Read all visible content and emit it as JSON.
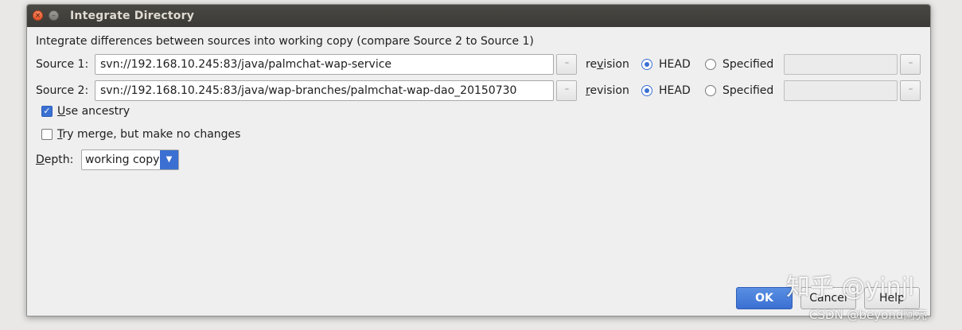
{
  "window": {
    "title": "Integrate Directory",
    "close_glyph": "×",
    "minimize_glyph": "–"
  },
  "description": "Integrate differences between sources into working copy (compare Source 2 to Source 1)",
  "source1": {
    "label": "Source 1:",
    "url": "svn://192.168.10.245:83/java/palmchat-wap-service",
    "browse_label": "···",
    "revision_pre": "re",
    "revision_mn": "v",
    "revision_post": "ision",
    "head_label": "HEAD",
    "specified_label": "Specified",
    "selected": "HEAD",
    "specified_value": "",
    "specified_browse_label": "···"
  },
  "source2": {
    "label": "Source 2:",
    "url": "svn://192.168.10.245:83/java/wap-branches/palmchat-wap-dao_20150730",
    "browse_label": "···",
    "revision_pre": "",
    "revision_mn": "r",
    "revision_post": "evision",
    "head_label": "HEAD",
    "specified_label": "Specified",
    "selected": "HEAD",
    "specified_value": "",
    "specified_browse_label": "···"
  },
  "options": {
    "use_ancestry": {
      "mn": "U",
      "rest": "se ancestry",
      "checked": true,
      "check_glyph": "✓"
    },
    "try_merge": {
      "mn": "T",
      "rest": "ry merge, but make no changes",
      "checked": false
    }
  },
  "depth": {
    "label_mn": "D",
    "label_rest": "epth:",
    "value": "working copy",
    "arrow_glyph": "▼"
  },
  "buttons": {
    "ok": "OK",
    "cancel": "Cancel",
    "help": "Help"
  },
  "watermark": {
    "line1": "知乎 @yinjl",
    "line2": "CSDN @beyond阿亮"
  }
}
